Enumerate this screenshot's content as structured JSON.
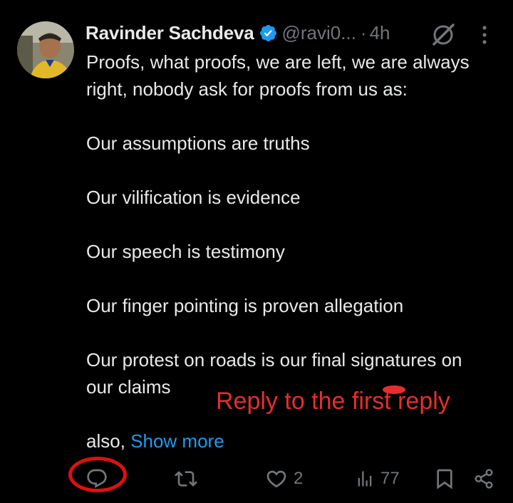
{
  "post": {
    "author": {
      "name": "Ravinder Sachdeva",
      "handle": "@ravi0...",
      "verified": true
    },
    "separator": "·",
    "time": "4h",
    "lines": [
      "Proofs, what proofs, we are left, we are always",
      "right, nobody ask for proofs from us as:",
      "Our assumptions are truths",
      "Our vilification is evidence",
      "Our speech is testimony",
      "Our finger pointing is proven allegation",
      "Our protest on roads is our final signatures on",
      "our claims"
    ],
    "tail_text": "also,",
    "show_more": "Show more"
  },
  "actions": {
    "reply_count": "",
    "repost_count": "",
    "like_count": "2",
    "views_count": "77"
  },
  "annotation": {
    "text": "Reply to the first reply",
    "color": "#e62d2d"
  },
  "icons": {
    "verified": "verified-badge-icon",
    "grok": "grok-icon",
    "more": "more-vertical-icon",
    "reply": "reply-icon",
    "repost": "repost-icon",
    "like": "heart-icon",
    "views": "views-icon",
    "bookmark": "bookmark-icon",
    "share": "share-icon"
  },
  "colors": {
    "background": "#000000",
    "text": "#e7e9ea",
    "muted": "#71767b",
    "link": "#1d9bf0",
    "verified": "#1d9bf0",
    "highlight": "#e00f0f"
  }
}
